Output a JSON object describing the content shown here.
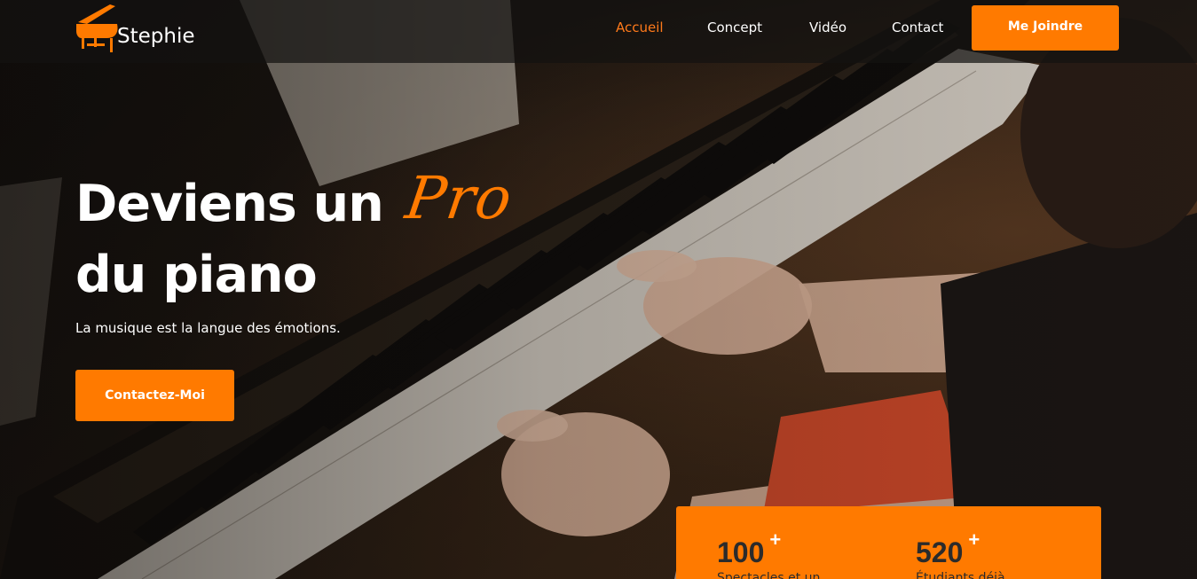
{
  "brand": {
    "name": "Stephie",
    "icon": "grand-piano-icon",
    "accent_color": "#ff7a00"
  },
  "nav": {
    "items": [
      {
        "label": "Accueil",
        "active": true
      },
      {
        "label": "Concept",
        "active": false
      },
      {
        "label": "Vidéo",
        "active": false
      },
      {
        "label": "Contact",
        "active": false
      }
    ],
    "cta_label": "Me Joindre"
  },
  "hero": {
    "title_part1": "Deviens un",
    "title_highlight": "Pro",
    "title_part2": "du piano",
    "subtitle": "La musique est la langue des émotions.",
    "cta_label": "Contactez-Moi"
  },
  "stats": [
    {
      "value": "100",
      "suffix": "+",
      "label": "Spectacles et un"
    },
    {
      "value": "520",
      "suffix": "+",
      "label": "Étudiants déjà"
    }
  ]
}
